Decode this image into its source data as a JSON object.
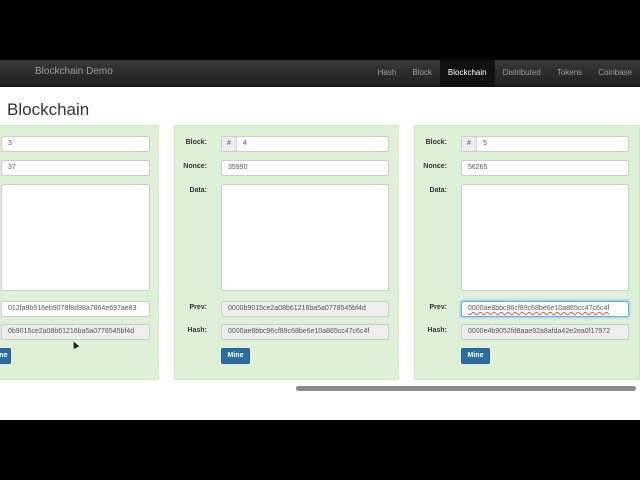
{
  "navbar": {
    "brand": "Blockchain Demo",
    "items": [
      "Hash",
      "Block",
      "Blockchain",
      "Distributed",
      "Tokens",
      "Coinbase"
    ],
    "active": "Blockchain"
  },
  "page": {
    "title": "Blockchain"
  },
  "labels": {
    "block": "Block:",
    "nonce": "Nonce:",
    "data": "Data:",
    "prev": "Prev:",
    "hash": "Hash:",
    "hash_symbol": "#"
  },
  "blocks": [
    {
      "block": "3",
      "nonce": "37",
      "data": "",
      "prev": "012fa9b916eb9078f8d98a7864e697ae83",
      "hash": "0b9015ce2a08b61216ba5a0778545bf4d",
      "mine_label": "ne"
    },
    {
      "block": "4",
      "nonce": "35990",
      "data": "",
      "prev": "0000b9015ce2a08b61216ba5a0778545bf4d",
      "hash": "0000ae8bbc96cf89c68be6e10a865cc47c6c4f",
      "mine_label": "Mine"
    },
    {
      "block": "5",
      "nonce": "56265",
      "data": "",
      "prev": "0000ae8bbc96cf89c68be6e10a865cc47c6c4f",
      "hash": "0000e4b9052fd8aae92a8afda42e2ea0f17972",
      "mine_label": "Mine"
    }
  ]
}
